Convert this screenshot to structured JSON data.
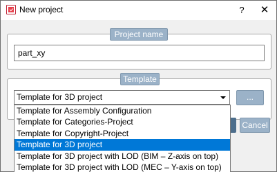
{
  "window": {
    "title": "New project",
    "help_glyph": "?",
    "close_glyph": "✕",
    "icon": "app-icon"
  },
  "project_name_group": {
    "legend": "Project name",
    "value": "part_xy"
  },
  "template_group": {
    "legend": "Template",
    "selected": "Template for 3D project",
    "browse_label": "..."
  },
  "dropdown": {
    "items": [
      "Template for Assembly Configuration",
      "Template for Categories-Project",
      "Template for Copyright-Project",
      "Template for 3D project",
      "Template for 3D project with LOD (BIM – Z-axis on top)",
      "Template for 3D project with LOD (MEC – Y-axis on top)"
    ],
    "highlighted_index": 3
  },
  "footer": {
    "cancel_label": "Cancel"
  },
  "colors": {
    "accent_button": "#9bb2c8",
    "selection": "#0078d7"
  }
}
